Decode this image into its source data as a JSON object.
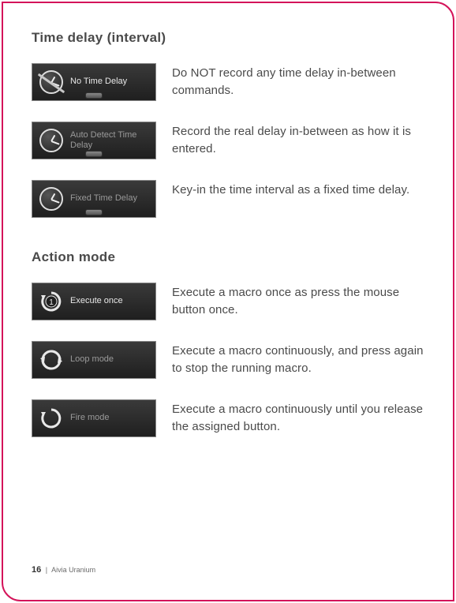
{
  "sections": {
    "time_delay": {
      "heading": "Time delay (interval)",
      "items": [
        {
          "icon_label": "No Time Delay",
          "desc": "Do NOT record any time delay in-between commands."
        },
        {
          "icon_label": "Auto Detect Time Delay",
          "desc": "Record the real delay in-between as how it is entered."
        },
        {
          "icon_label": "Fixed Time Delay",
          "desc": "Key-in the time interval as a fixed time delay."
        }
      ]
    },
    "action_mode": {
      "heading": "Action mode",
      "items": [
        {
          "icon_label": "Execute once",
          "badge": "1",
          "desc": "Execute a macro once as press the mouse button once."
        },
        {
          "icon_label": "Loop mode",
          "badge": "",
          "desc": "Execute a macro continuously, and press again to stop the running macro."
        },
        {
          "icon_label": "Fire mode",
          "badge": "",
          "desc": "Execute a macro continuously until you release the assigned button."
        }
      ]
    }
  },
  "footer": {
    "page": "16",
    "separator": "|",
    "product": "Aivia Uranium"
  }
}
